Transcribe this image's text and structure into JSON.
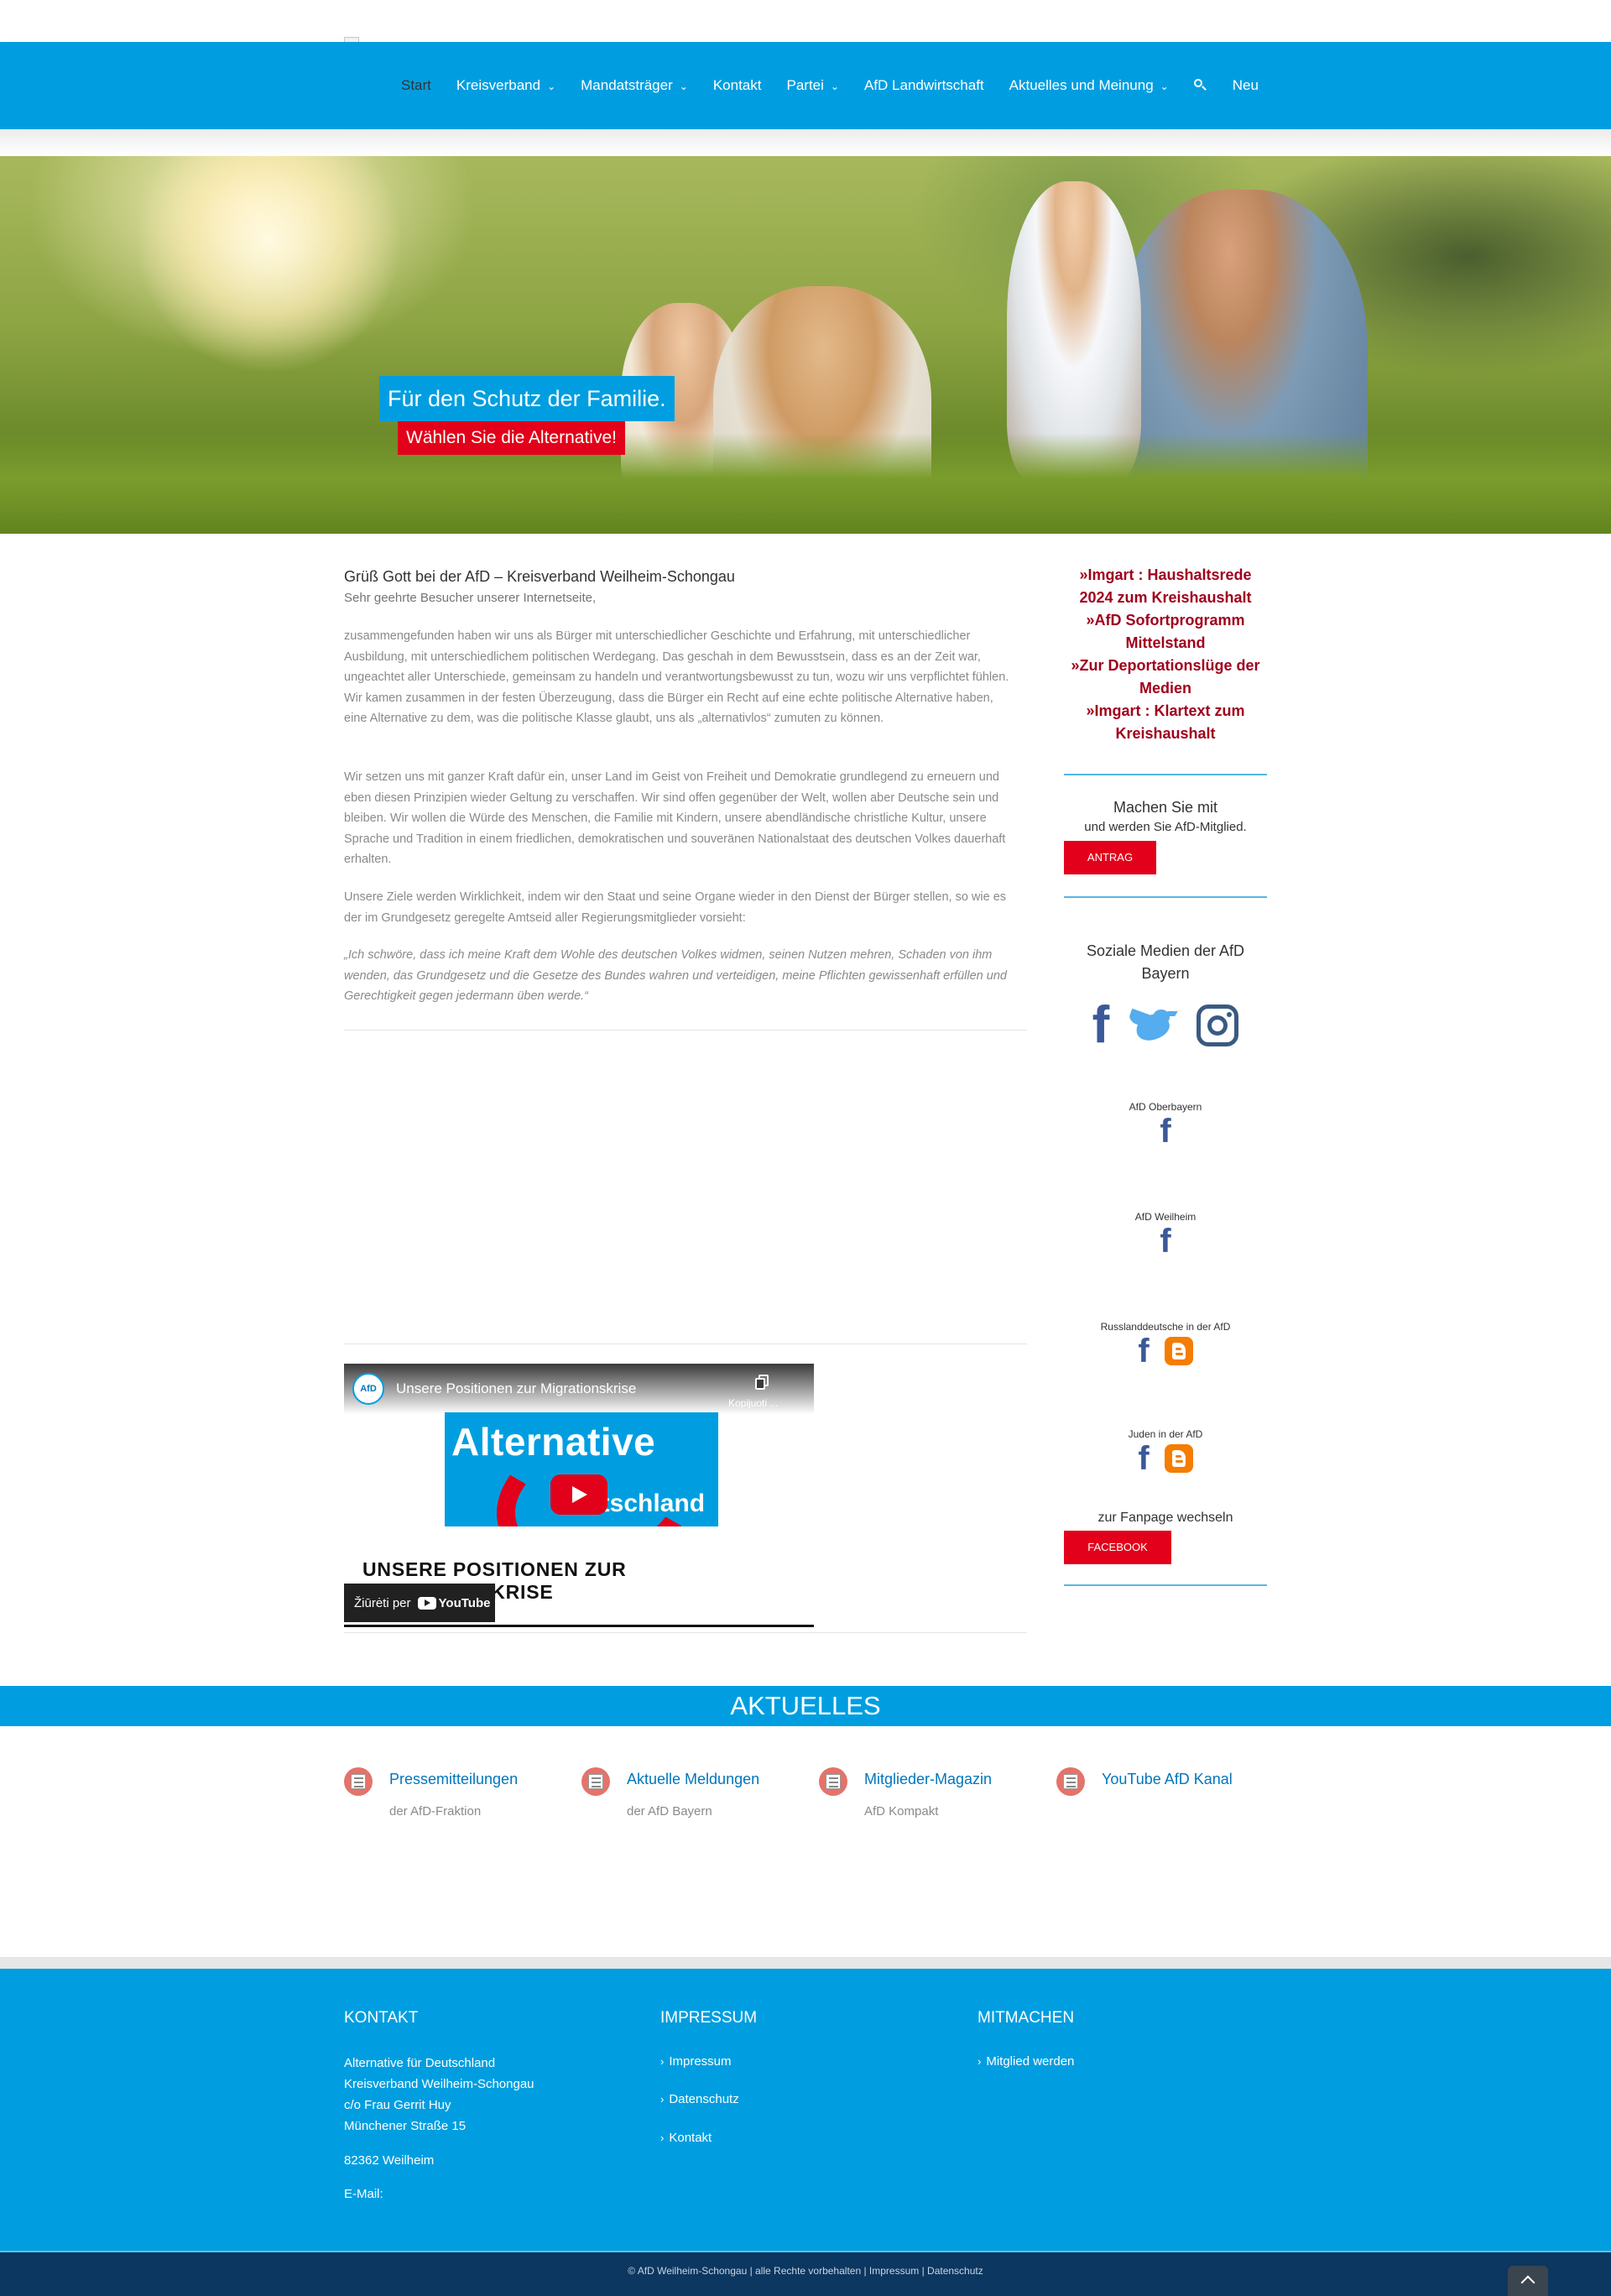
{
  "header": {
    "nav": [
      {
        "label": "Start",
        "active": true,
        "dropdown": false
      },
      {
        "label": "Kreisverband",
        "active": false,
        "dropdown": true
      },
      {
        "label": "Mandatsträger",
        "active": false,
        "dropdown": true
      },
      {
        "label": "Kontakt",
        "active": false,
        "dropdown": false
      },
      {
        "label": "Partei",
        "active": false,
        "dropdown": true
      },
      {
        "label": "AfD Landwirtschaft",
        "active": false,
        "dropdown": false
      },
      {
        "label": "Aktuelles und Meinung",
        "active": false,
        "dropdown": true
      }
    ],
    "neu_label": "Neu",
    "chevron": "⌄"
  },
  "hero": {
    "title": "Für den Schutz der Familie.",
    "subtitle": "Wählen Sie die Alternative!"
  },
  "main": {
    "title": "Grüß Gott bei der AfD – Kreisverband Weilheim-Schongau",
    "intro": "Sehr geehrte Besucher unserer Internetseite,",
    "paragraphs": [
      "zusammengefunden haben wir uns als Bürger mit unterschiedlicher Geschichte und Erfahrung, mit unterschiedlicher Ausbildung, mit unterschiedlichem politischen Werdegang. Das geschah in dem Bewusstsein, dass es an der Zeit war, ungeachtet aller Unterschiede, gemeinsam zu handeln und verantwortungsbewusst zu tun, wozu wir uns verpflichtet fühlen. Wir kamen zusammen in der festen Überzeugung, dass die Bürger ein Recht auf eine echte politische Alternative haben, eine Alternative zu dem, was die politische Klasse glaubt, uns als „alternativlos“ zumuten zu können.",
      "Wir setzen uns mit ganzer Kraft dafür ein, unser Land im Geist von Freiheit und Demokratie grundlegend zu erneuern und eben diesen Prinzipien wieder Geltung zu verschaffen. Wir sind offen gegenüber der Welt, wollen aber Deutsche sein und bleiben. Wir wollen die Würde des Menschen, die Familie mit Kindern, unsere abendländische christliche Kultur, unsere Sprache und Tradition in einem friedlichen, demokratischen und souveränen Nationalstaat des deutschen Volkes dauerhaft erhalten.",
      "Unsere Ziele werden Wirklichkeit, indem wir den Staat und seine Organe wieder in den Dienst der Bürger stellen, so wie es der im Grundgesetz geregelte Amtseid aller Regierungsmitglieder vorsieht:"
    ],
    "quote": "„Ich schwöre, dass ich meine Kraft dem Wohle des deutschen Volkes widmen, seinen Nutzen mehren, Schaden von ihm wenden, das Grundgesetz und die Gesetze des Bundes wahren und verteidigen, meine Pflichten gewissenhaft erfüllen und Gerechtigkeit gegen jedermann üben werde.“",
    "video": {
      "channel_badge": "AfD",
      "title": "Unsere Positionen zur Migrationskrise",
      "copy_label": "Kopijuoti ...",
      "thumb_top": "Alternative",
      "thumb_bottom": "Deutschland",
      "caption": "UNSERE POSITIONEN ZUR MIGRATIONSKRISE",
      "watch_label": "Žiūrėti per",
      "yt_label": "YouTube"
    }
  },
  "sidebar": {
    "news": [
      "»Imgart : Haushaltsrede 2024 zum Kreishaushalt",
      "»AfD Sofortprogramm Mittelstand",
      "»Zur Deportationslüge der Medien",
      "»Imgart : Klartext zum Kreishaushalt"
    ],
    "join_title": "Machen Sie mit",
    "join_sub": "und werden Sie AfD-Mitglied.",
    "join_button": "ANTRAG",
    "social_title": "Soziale Medien der AfD Bayern",
    "pages": [
      {
        "label": "AfD Oberbayern"
      },
      {
        "label": "AfD Weilheim"
      },
      {
        "label": "Russlanddeutsche in der AfD"
      },
      {
        "label": "Juden in der AfD"
      }
    ],
    "fanpage_label": "zur Fanpage wechseln",
    "fanpage_button": "FACEBOOK"
  },
  "aktuelles": {
    "heading": "AKTUELLES",
    "items": [
      {
        "title": "Pressemitteilungen",
        "sub": "der AfD-Fraktion"
      },
      {
        "title": "Aktuelle Meldungen",
        "sub": "der AfD Bayern"
      },
      {
        "title": "Mitglieder-Magazin",
        "sub": "AfD Kompakt"
      },
      {
        "title": "YouTube AfD Kanal",
        "sub": ""
      }
    ]
  },
  "footer": {
    "kontakt": {
      "heading": "KONTAKT",
      "lines": [
        "Alternative für Deutschland",
        "Kreisverband Weilheim-Schongau",
        "c/o Frau Gerrit Huy",
        "Münchener Straße 15"
      ],
      "city": "82362 Weilheim",
      "email_label": "E-Mail:"
    },
    "impressum": {
      "heading": "IMPRESSUM",
      "links": [
        "Impressum",
        "Datenschutz",
        "Kontakt"
      ]
    },
    "mitmachen": {
      "heading": "MITMACHEN",
      "links": [
        "Mitglied werden"
      ]
    },
    "copyright": "© AfD Weilheim-Schongau | alle Rechte vorbehalten | Impressum | Datenschutz"
  },
  "colors": {
    "primary_blue": "#009ee0",
    "accent_red": "#e2001a",
    "news_red": "#a0001c",
    "footer_dark": "#0b3760"
  }
}
